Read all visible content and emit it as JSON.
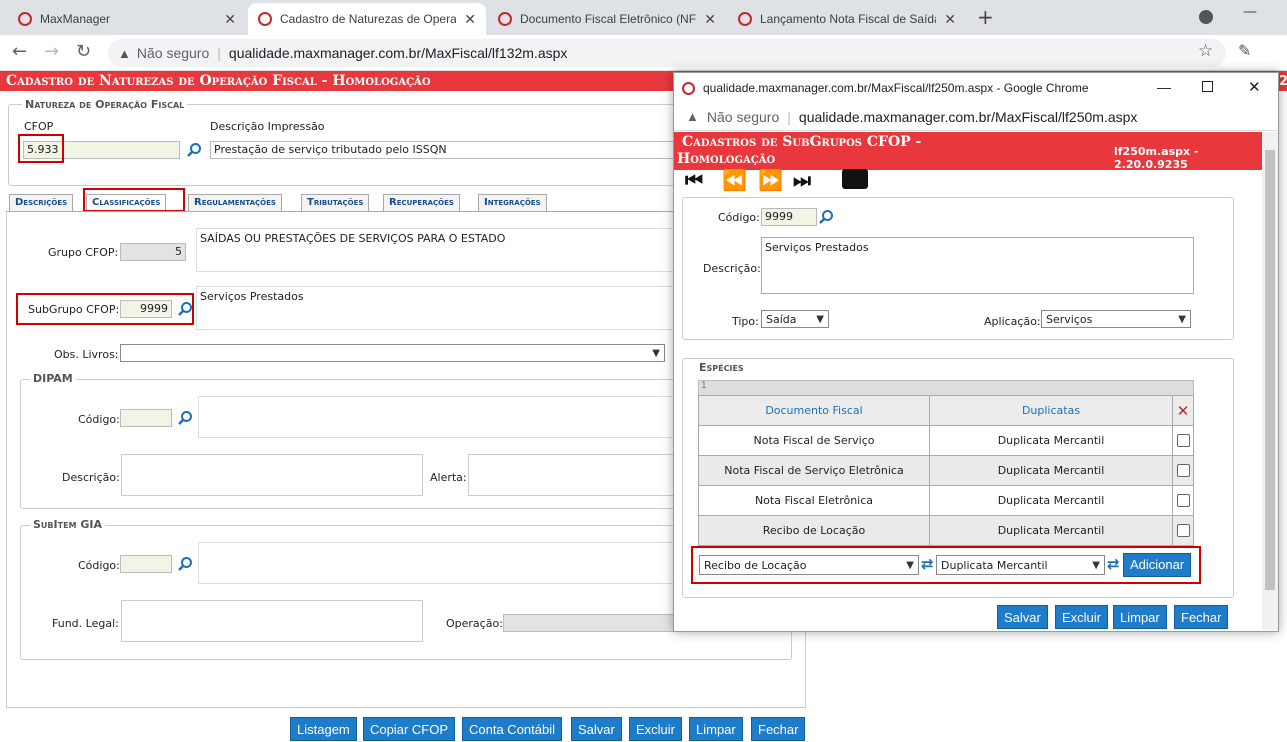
{
  "browser": {
    "tabs": [
      {
        "label": "MaxManager"
      },
      {
        "label": "Cadastro de Naturezas de Opera"
      },
      {
        "label": "Documento Fiscal Eletrônico (NF"
      },
      {
        "label": "Lançamento Nota Fiscal de Saída"
      }
    ],
    "security": "Não seguro",
    "url": "qualidade.maxmanager.com.br/MaxFiscal/lf132m.aspx"
  },
  "main": {
    "title": "Cadastro de Naturezas de Operação Fiscal  - Homologação",
    "natureza": {
      "legend": "Natureza de Operação Fiscal",
      "cfop_label": "CFOP",
      "cfop_value": "5.933",
      "desc_label": "Descrição Impressão",
      "desc_value": "Prestação de serviço tributado pelo ISSQN"
    },
    "tabs": [
      "Descrições",
      "Classificações",
      "Regulamentações",
      "Tributações",
      "Recuperações",
      "Integrações"
    ],
    "grupo_label": "Grupo CFOP:",
    "grupo_value": "5",
    "grupo_desc": "SAÍDAS OU PRESTAÇÕES DE SERVIÇOS PARA O ESTADO",
    "subgrupo_label": "SubGrupo CFOP:",
    "subgrupo_value": "9999",
    "subgrupo_desc": "Serviços Prestados",
    "obs_label": "Obs. Livros:",
    "dipam": {
      "legend": "DIPAM",
      "codigo_label": "Código:",
      "descricao_label": "Descrição:",
      "alerta_label": "Alerta:"
    },
    "gia": {
      "legend": "SubItem GIA",
      "codigo_label": "Código:",
      "fund_label": "Fund. Legal:",
      "operacao_label": "Operação:"
    },
    "buttons": [
      "Listagem",
      "Copiar CFOP",
      "Conta Contábil",
      "Salvar",
      "Excluir",
      "Limpar",
      "Fechar"
    ]
  },
  "popup": {
    "window_title": "qualidade.maxmanager.com.br/MaxFiscal/lf250m.aspx - Google Chrome",
    "security": "Não seguro",
    "url": "qualidade.maxmanager.com.br/MaxFiscal/lf250m.aspx",
    "header_line1": "Cadastros de SubGrupos CFOP  -",
    "header_line2": "Homologação",
    "version": "lf250m.aspx - 2.20.0.9235",
    "codigo_label": "Código:",
    "codigo_value": "9999",
    "descricao_label": "Descrição:",
    "descricao_value": "Serviços Prestados",
    "tipo_label": "Tipo:",
    "tipo_value": "Saída",
    "aplicacao_label": "Aplicação:",
    "aplicacao_value": "Serviços",
    "especies_legend": "Espécies",
    "grid_page": "1",
    "col_documento": "Documento Fiscal",
    "col_duplicatas": "Duplicatas",
    "rows": [
      {
        "doc": "Nota Fiscal de Serviço",
        "dup": "Duplicata Mercantil"
      },
      {
        "doc": "Nota Fiscal de Serviço Eletrônica",
        "dup": "Duplicata Mercantil"
      },
      {
        "doc": "Nota Fiscal Eletrônica",
        "dup": "Duplicata Mercantil"
      },
      {
        "doc": "Recibo de Locação",
        "dup": "Duplicata Mercantil"
      }
    ],
    "doc_select": "Recibo de Locação",
    "dup_select": "Duplicata Mercantil",
    "adicionar": "Adicionar",
    "buttons": [
      "Salvar",
      "Excluir",
      "Limpar",
      "Fechar"
    ]
  },
  "colors": {
    "brand_red": "#e8383d",
    "button_blue": "#1e7cc8",
    "highlight_red": "#d00000"
  }
}
